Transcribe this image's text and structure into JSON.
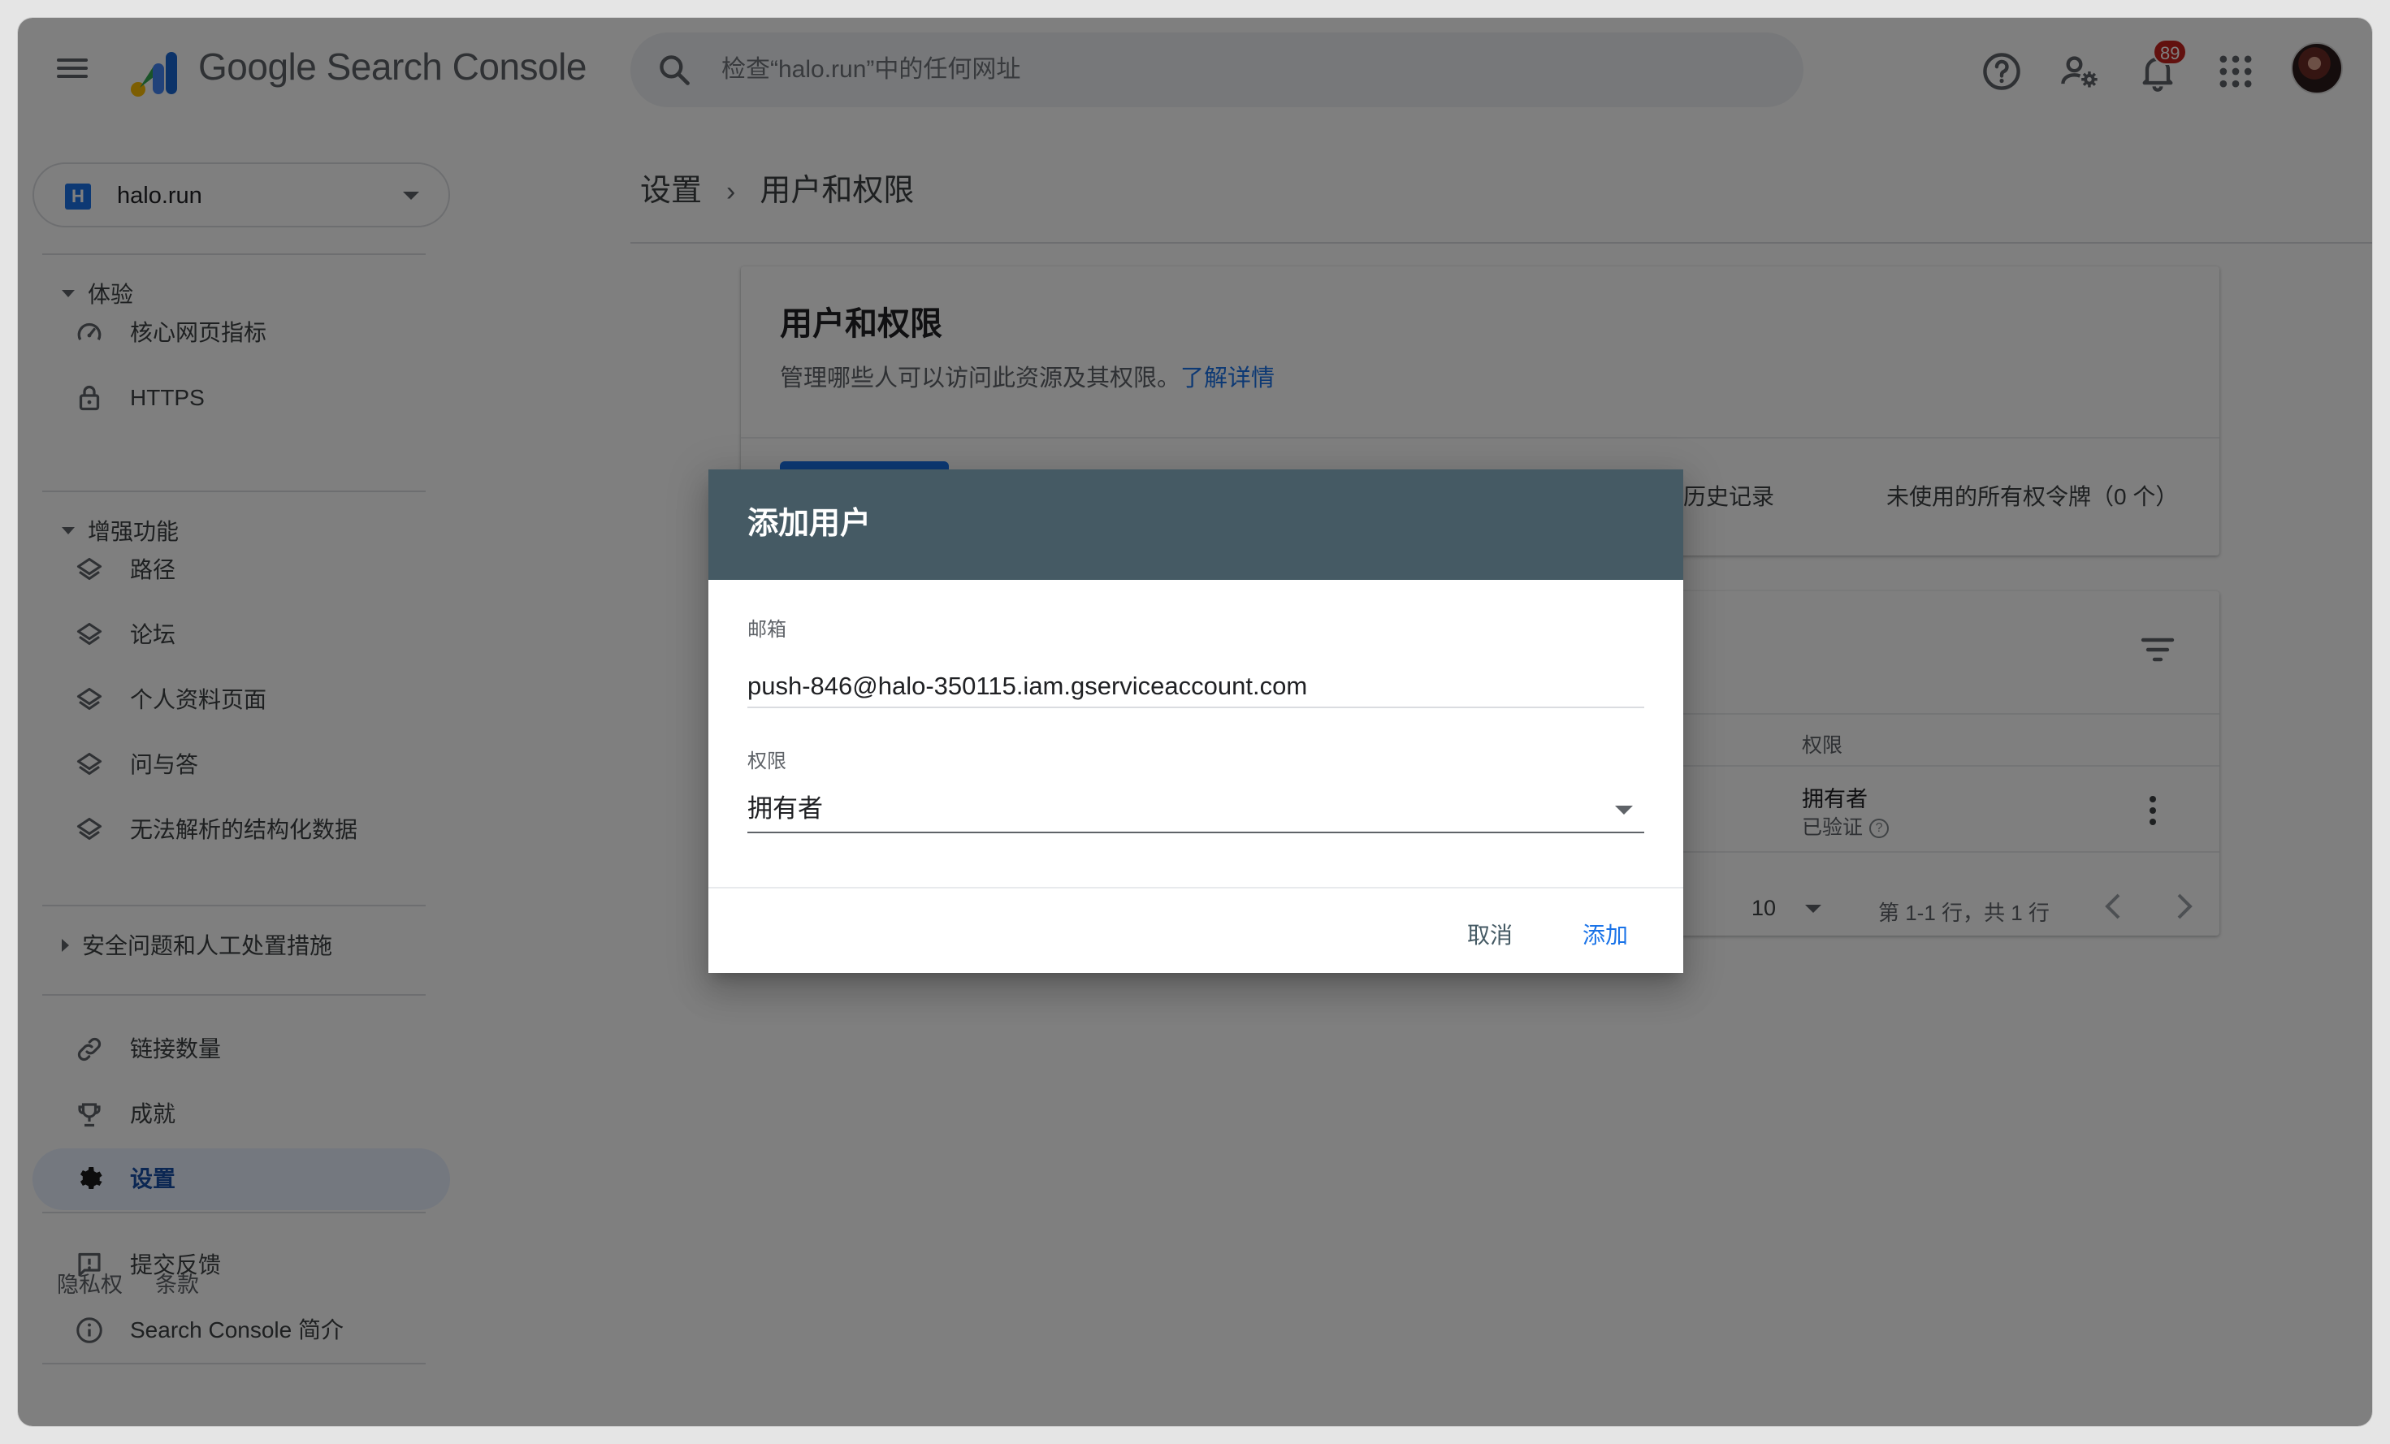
{
  "header": {
    "brand": "Google Search Console",
    "search_placeholder": "检查“halo.run”中的任何网址",
    "notification_count": "89"
  },
  "sidebar": {
    "property": {
      "icon_letter": "H",
      "name": "halo.run"
    },
    "sections": [
      {
        "label": "体验",
        "expanded": true,
        "items": [
          {
            "label": "核心网页指标",
            "icon": "gauge-icon"
          },
          {
            "label": "HTTPS",
            "icon": "lock-icon"
          }
        ]
      },
      {
        "label": "增强功能",
        "expanded": true,
        "items": [
          {
            "label": "路径",
            "icon": "layers-icon"
          },
          {
            "label": "论坛",
            "icon": "layers-icon"
          },
          {
            "label": "个人资料页面",
            "icon": "layers-icon"
          },
          {
            "label": "问与答",
            "icon": "layers-icon"
          },
          {
            "label": "无法解析的结构化数据",
            "icon": "layers-icon"
          }
        ]
      },
      {
        "label": "安全问题和人工处置措施",
        "expanded": false,
        "items": []
      }
    ],
    "bottom_items": [
      {
        "label": "链接数量",
        "icon": "link-icon"
      },
      {
        "label": "成就",
        "icon": "trophy-icon"
      },
      {
        "label": "设置",
        "icon": "gear-icon",
        "active": true
      }
    ],
    "help_items": [
      {
        "label": "提交反馈",
        "icon": "feedback-icon"
      },
      {
        "label": "Search Console 简介",
        "icon": "info-icon"
      }
    ],
    "footer": {
      "privacy": "隐私权",
      "terms": "条款"
    }
  },
  "main": {
    "breadcrumb": [
      "设置",
      "用户和权限"
    ],
    "card": {
      "title": "用户和权限",
      "description": "管理哪些人可以访问此资源及其权限。",
      "learn_more": "了解详情",
      "tab_history": "有权历史记录",
      "tab_tokens": "未使用的所有权令牌（0 个）"
    },
    "table": {
      "column_permission": "权限",
      "rows": [
        {
          "permission": "拥有者",
          "status": "已验证"
        }
      ],
      "rows_per_page_label": "：",
      "rows_per_page": "10",
      "range": "第 1-1 行，共 1 行"
    }
  },
  "dialog": {
    "title": "添加用户",
    "email_label": "邮箱",
    "email_value": "push-846@halo-350115.iam.gserviceaccount.com",
    "permission_label": "权限",
    "permission_value": "拥有者",
    "cancel": "取消",
    "add": "添加"
  },
  "colors": {
    "accent": "#1a73e8",
    "dialog_header": "#455a64",
    "badge": "#c5221f"
  }
}
